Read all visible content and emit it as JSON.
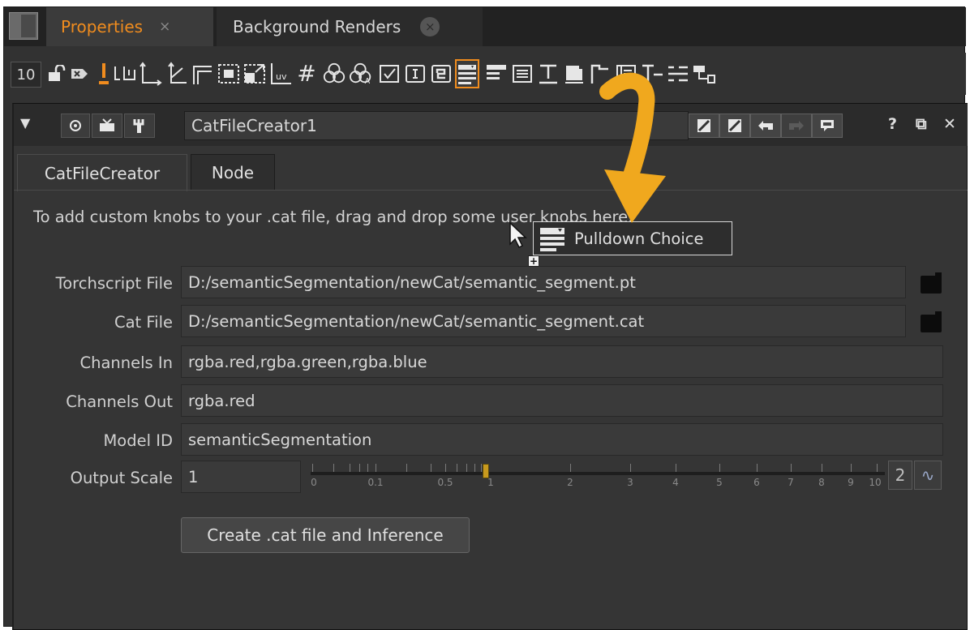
{
  "tabs": [
    {
      "label": "Properties",
      "close": "×"
    },
    {
      "label": "Background Renders",
      "close": "×"
    }
  ],
  "toolbar": {
    "count": "10",
    "icons": [
      "lock-icon",
      "clear-icon",
      "pin-icon",
      "int-knob-icon",
      "xy-knob-icon",
      "xyz-knob-icon",
      "wh-knob-icon",
      "bbox-knob-icon",
      "size-knob-icon",
      "uv-knob-icon",
      "hash-icon",
      "rgb-icon",
      "rgba-icon",
      "checkbox-icon",
      "text-input-icon",
      "python-icon",
      "pulldown-icon",
      "cascade-icon",
      "multiline-text-icon",
      "text-icon",
      "file-icon",
      "tab-icon",
      "list-icon",
      "text-divider-icon",
      "divider-icon",
      "group-icon"
    ]
  },
  "panel": {
    "node_name": "CatFileCreator1",
    "help": "?",
    "float": "⧉",
    "close": "✕",
    "subtabs": [
      "CatFileCreator",
      "Node"
    ],
    "hint": "To add custom knobs to your .cat file, drag and drop some user knobs here.",
    "fields": [
      {
        "label": "Torchscript File",
        "value": "D:/semanticSegmentation/newCat/semantic_segment.pt"
      },
      {
        "label": "Cat File",
        "value": "D:/semanticSegmentation/newCat/semantic_segment.cat"
      },
      {
        "label": "Channels In",
        "value": "rgba.red,rgba.green,rgba.blue"
      },
      {
        "label": "Channels Out",
        "value": "rgba.red"
      },
      {
        "label": "Model ID",
        "value": "semanticSegmentation"
      }
    ],
    "output_scale": {
      "label": "Output Scale",
      "value": "1",
      "slider_value": 1,
      "ticks": [
        "0",
        "0.1",
        "0.5",
        "1",
        "2",
        "3",
        "4",
        "5",
        "6",
        "7",
        "8",
        "9",
        "10"
      ],
      "views_button": "2",
      "curve_button": "∿"
    },
    "action_button": "Create .cat file and Inference"
  },
  "drag_tooltip": {
    "label": "Pulldown Choice",
    "plus": "+"
  },
  "colors": {
    "accent": "#f08c1e",
    "arrow": "#f0a81e"
  }
}
